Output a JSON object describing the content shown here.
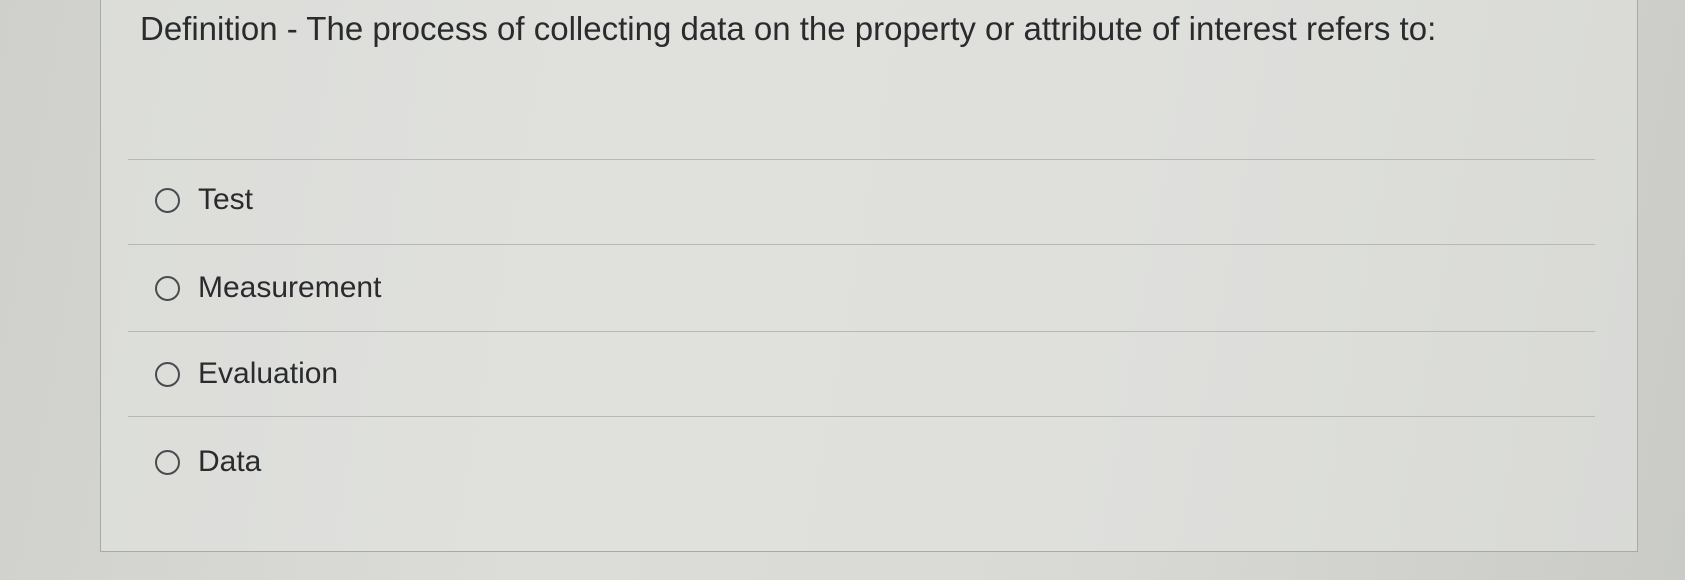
{
  "question": {
    "text": "Definition - The process of collecting data on the property or attribute of interest refers to:"
  },
  "options": [
    {
      "label": "Test",
      "selected": false
    },
    {
      "label": "Measurement",
      "selected": false
    },
    {
      "label": "Evaluation",
      "selected": false
    },
    {
      "label": "Data",
      "selected": false
    }
  ]
}
